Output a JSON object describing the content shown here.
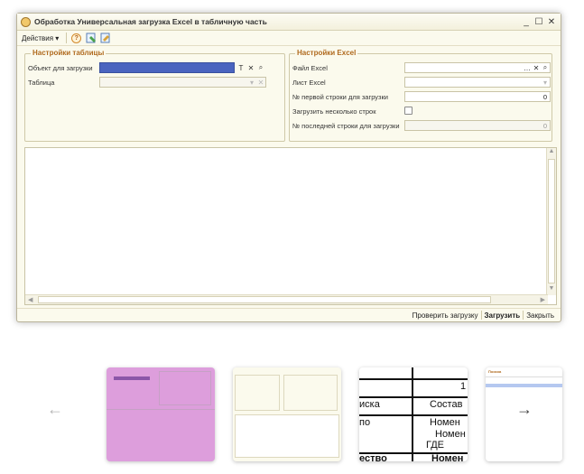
{
  "window": {
    "title": "Обработка  Универсальная загрузка Excel в табличную часть",
    "controls": {
      "minimize": "_",
      "maximize": "☐",
      "close": "✕"
    }
  },
  "toolbar": {
    "actions_label": "Действия",
    "actions_arrow": "▾"
  },
  "table_settings": {
    "title": "Настройки таблицы",
    "object_label": "Объект для загрузки",
    "table_label": "Таблица"
  },
  "excel_settings": {
    "title": "Настройки Excel",
    "file_label": "Файл Excel",
    "sheet_label": "Лист Excel",
    "first_row_label": "№ первой строки для загрузки",
    "first_row_value": "0",
    "multi_rows_label": "Загрузить несколько строк",
    "last_row_label": "№ последней строки для загрузки",
    "last_row_value": "0"
  },
  "buttons": {
    "check": "Проверить загрузку",
    "load": "Загрузить",
    "close": "Закрыть"
  },
  "carousel": {
    "prev": "←",
    "next": "→",
    "slide3": {
      "r1c2": "1",
      "r2c1": "иска",
      "r2c2": "Состав",
      "r3c1": "по",
      "r3c2": "Номен",
      "r4c2": "Номен",
      "r5c2": "ГДЕ",
      "r6c1": "ество",
      "r6c2": "Номен"
    },
    "slide4": {
      "header": "Поиска"
    }
  },
  "colors": {
    "accent_orange": "#b06a1e",
    "selected_field": "#4a64bf",
    "window_bg": "#fbfaed"
  }
}
